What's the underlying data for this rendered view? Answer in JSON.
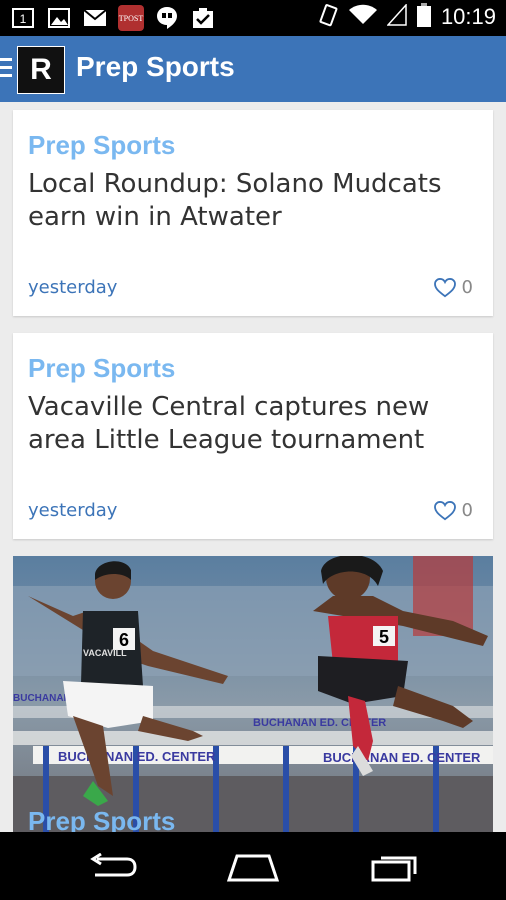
{
  "status_bar": {
    "time": "10:19",
    "notification_icons": [
      "1-icon",
      "image-icon",
      "gmail-icon",
      "tpost-icon",
      "hangouts-icon",
      "tasks-icon"
    ]
  },
  "app_bar": {
    "logo_letter": "R",
    "title": "Prep Sports",
    "color": "#3c74b8"
  },
  "feed": {
    "articles": [
      {
        "category": "Prep Sports",
        "headline": "Local Roundup: Solano Mudcats earn win in Atwater",
        "time": "yesterday",
        "likes": "0"
      },
      {
        "category": "Prep Sports",
        "headline": "Vacaville Central captures new area Little League tournament",
        "time": "yesterday",
        "likes": "0"
      }
    ],
    "photo_article": {
      "category": "Prep Sports",
      "banner_text": "BUCHANAN ED. CENTER",
      "bib_left": "6",
      "bib_right": "5",
      "jersey_left": "VACAVILL"
    }
  },
  "colors": {
    "accent": "#3c74b8",
    "category": "#7ab8f0"
  }
}
